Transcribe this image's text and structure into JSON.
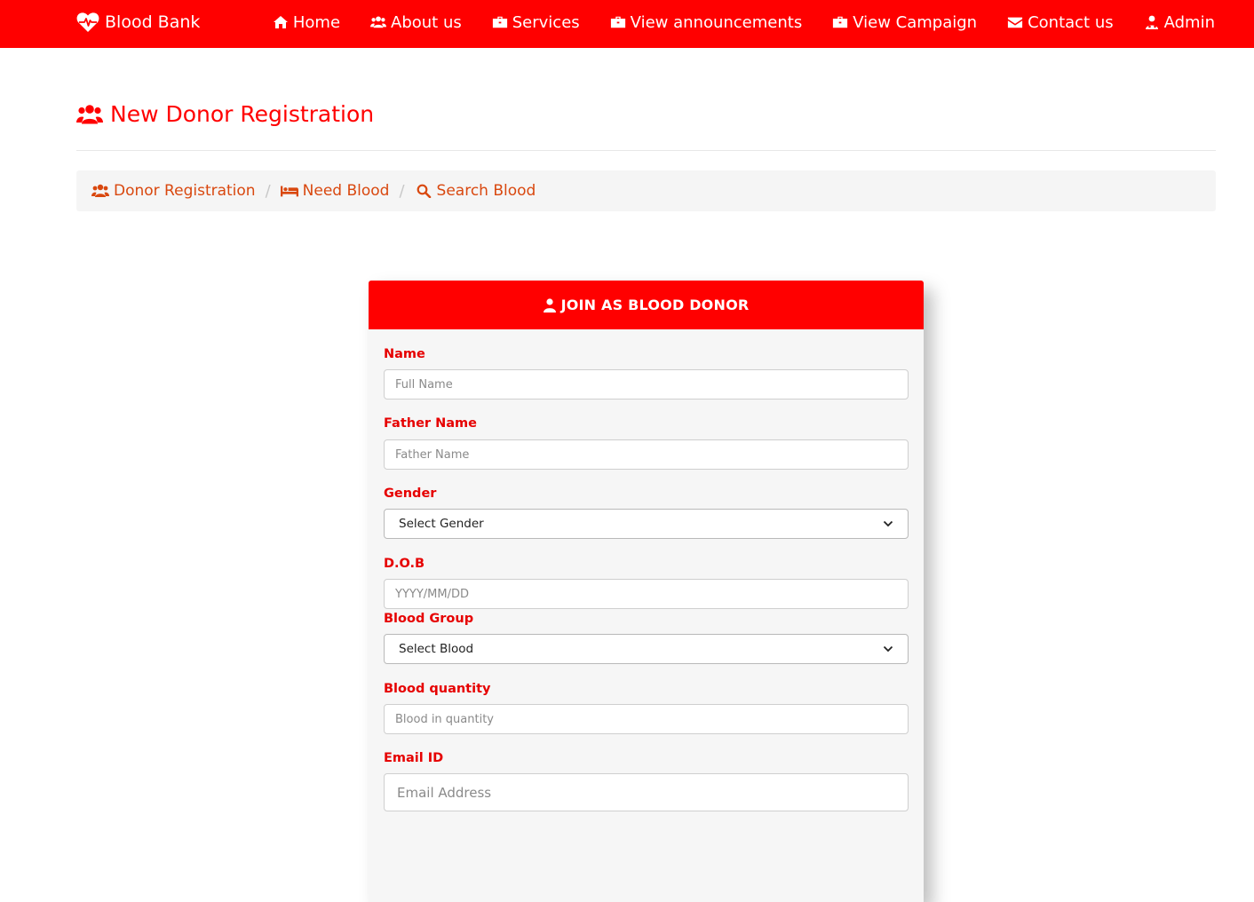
{
  "brand": {
    "name": "Blood Bank",
    "icon": "heartbeat-icon"
  },
  "nav": {
    "items": [
      {
        "label": "Home",
        "icon": "home-icon"
      },
      {
        "label": "About us",
        "icon": "users-icon"
      },
      {
        "label": "Services",
        "icon": "briefcase-icon"
      },
      {
        "label": "View announcements",
        "icon": "briefcase-icon"
      },
      {
        "label": "View Campaign",
        "icon": "briefcase-icon"
      },
      {
        "label": "Contact us",
        "icon": "envelope-icon"
      },
      {
        "label": "Admin",
        "icon": "user-md-icon"
      }
    ]
  },
  "page": {
    "title": "New Donor Registration"
  },
  "breadcrumb": {
    "items": [
      {
        "label": "Donor Registration",
        "icon": "users-icon"
      },
      {
        "label": "Need Blood",
        "icon": "bed-icon"
      },
      {
        "label": "Search Blood",
        "icon": "search-icon"
      }
    ],
    "separator": "/"
  },
  "form": {
    "heading": "JOIN AS BLOOD DONOR",
    "fields": {
      "name": {
        "label": "Name",
        "placeholder": "Full Name"
      },
      "father": {
        "label": "Father Name",
        "placeholder": "Father Name"
      },
      "gender": {
        "label": "Gender",
        "value": "Select Gender"
      },
      "dob": {
        "label": "D.O.B",
        "placeholder": "YYYY/MM/DD"
      },
      "blood_group": {
        "label": "Blood Group",
        "value": "Select Blood"
      },
      "quantity": {
        "label": "Blood quantity",
        "placeholder": "Blood in quantity"
      },
      "email": {
        "label": "Email ID",
        "placeholder": "Email Address"
      }
    }
  },
  "colors": {
    "primary": "#ff0000",
    "link": "#d9480f",
    "breadcrumb_bg": "#f5f5f5",
    "card_bg": "#f6f6f6"
  }
}
